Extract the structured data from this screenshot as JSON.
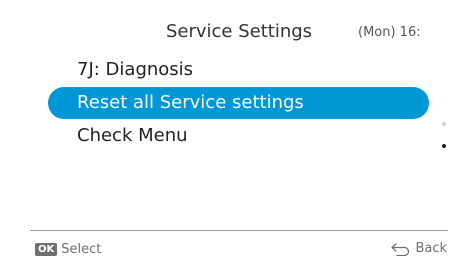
{
  "header": {
    "title": "Service Settings",
    "clock": "(Mon) 16:"
  },
  "menu": {
    "items": [
      {
        "label": "7J: Diagnosis",
        "selected": false
      },
      {
        "label": "Reset all Service settings",
        "selected": true
      },
      {
        "label": "Check Menu",
        "selected": false
      }
    ]
  },
  "footer": {
    "ok_badge": "OK",
    "select_label": "Select",
    "back_label": "Back",
    "back_icon": "return-arrow-icon"
  },
  "colors": {
    "selection": "#0097d6",
    "text": "#222222",
    "hint_text": "#707070",
    "scroll_dot_inactive": "#cfcfcf",
    "scroll_dot_active": "#222222"
  },
  "scroll": {
    "pages": 2,
    "current_page": 2
  }
}
